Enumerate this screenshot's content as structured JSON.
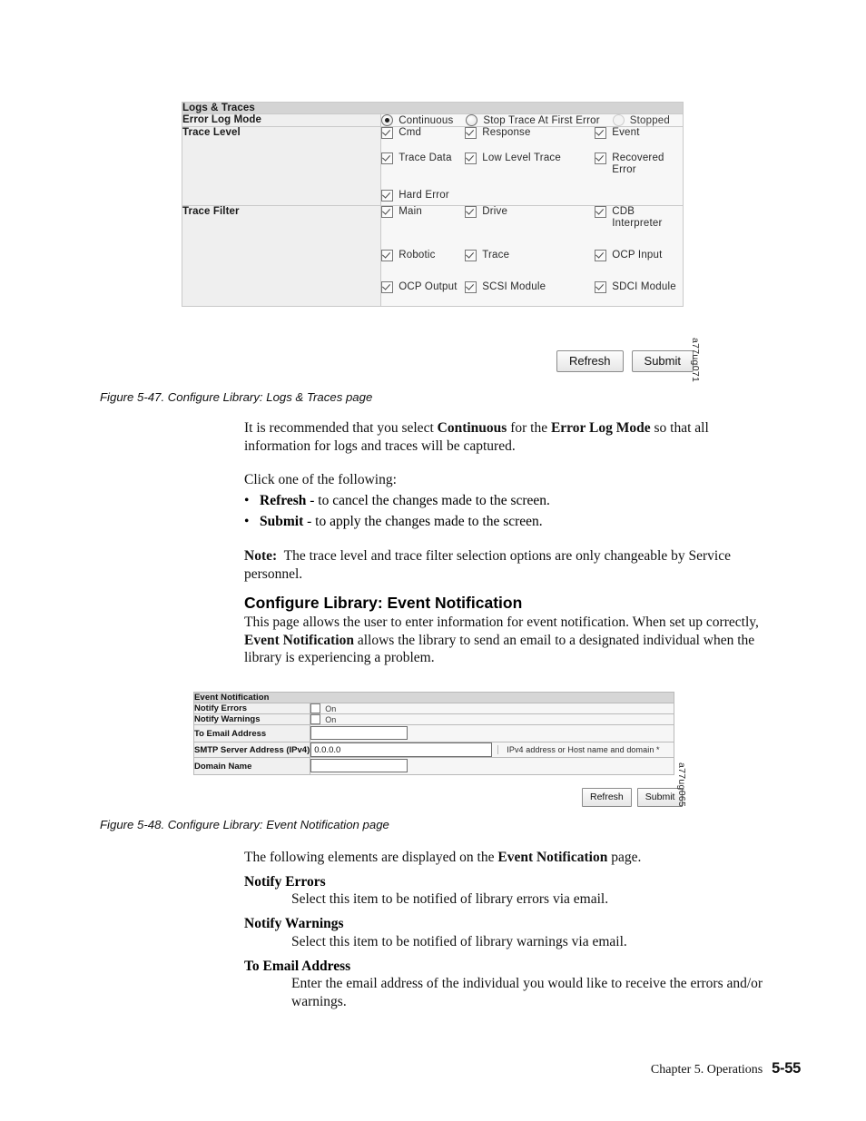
{
  "figure1": {
    "screenshot": {
      "title": "Logs & Traces",
      "rows": {
        "error_log_mode_label": "Error Log Mode",
        "trace_level_label": "Trace Level",
        "trace_filter_label": "Trace Filter"
      },
      "error_log_mode_options": [
        {
          "label": "Continuous",
          "state": "selected"
        },
        {
          "label": "Stop Trace At First Error",
          "state": "unselected"
        },
        {
          "label": "Stopped",
          "state": "disabled"
        }
      ],
      "trace_level_options": [
        {
          "label": "Cmd",
          "checked": true
        },
        {
          "label": "Response",
          "checked": true
        },
        {
          "label": "Event",
          "checked": true
        },
        {
          "label": "Trace Data",
          "checked": true
        },
        {
          "label": "Low Level Trace",
          "checked": true
        },
        {
          "label": "Recovered Error",
          "checked": true
        },
        {
          "label": "Hard Error",
          "checked": true
        }
      ],
      "trace_filter_options": [
        {
          "label": "Main",
          "checked": true
        },
        {
          "label": "Drive",
          "checked": true
        },
        {
          "label": "CDB Interpreter",
          "checked": true
        },
        {
          "label": "Robotic",
          "checked": true
        },
        {
          "label": "Trace",
          "checked": true
        },
        {
          "label": "OCP Input",
          "checked": true
        },
        {
          "label": "OCP Output",
          "checked": true
        },
        {
          "label": "SCSI Module",
          "checked": true
        },
        {
          "label": "SDCI Module",
          "checked": true
        }
      ],
      "buttons": {
        "refresh": "Refresh",
        "submit": "Submit"
      },
      "side_code": "a77ug071"
    },
    "caption": "Figure 5-47. Configure Library: Logs & Traces page"
  },
  "figure2": {
    "screenshot": {
      "title": "Event Notification",
      "rows": [
        {
          "label": "Notify Errors",
          "control": "checkbox",
          "value": "On",
          "checked": false
        },
        {
          "label": "Notify Warnings",
          "control": "checkbox",
          "value": "On",
          "checked": false
        },
        {
          "label": "To Email Address",
          "control": "text",
          "value": ""
        },
        {
          "label": "SMTP Server Address (IPv4)",
          "control": "text",
          "value": "0.0.0.0",
          "hint": "IPv4 address or Host name and domain *"
        },
        {
          "label": "Domain Name",
          "control": "text",
          "value": ""
        }
      ],
      "buttons": {
        "refresh": "Refresh",
        "submit": "Submit"
      },
      "side_code": "a77ug065"
    },
    "caption": "Figure 5-48. Configure Library: Event Notification page"
  },
  "body": {
    "para_recommend_line1_a": "It is recommended that you select ",
    "para_recommend_bold1": "Continuous",
    "para_recommend_line1_b": " for the ",
    "para_recommend_bold2": "Error Log Mode",
    "para_recommend_line1_c": " so that all information for logs and traces will be captured.",
    "click_one_of": "Click one of the following:",
    "bullets": [
      {
        "bold": "Refresh",
        "rest": " - to cancel the changes made to the screen."
      },
      {
        "bold": "Submit",
        "rest": " - to apply the changes made to the screen."
      }
    ],
    "note_label": "Note:",
    "note_text": "The trace level and trace filter selection options are only changeable by Service personnel.",
    "section_heading": "Configure Library: Event Notification",
    "para_event_a": "This page allows the user to enter information for event notification. When set up correctly, ",
    "para_event_bold": "Event Notification",
    "para_event_b": " allows the library to send an email to a designated individual when the library is experiencing a problem.",
    "elements_intro_a": "The following elements are displayed on the ",
    "elements_intro_bold": "Event Notification",
    "elements_intro_b": " page.",
    "definitions": [
      {
        "term": "Notify Errors",
        "desc": "Select this item to be notified of library errors via email."
      },
      {
        "term": "Notify Warnings",
        "desc": "Select this item to be notified of library warnings via email."
      },
      {
        "term": "To Email Address",
        "desc": "Enter the email address of the individual you would like to receive the errors and/or warnings."
      }
    ]
  },
  "footer": {
    "chapter": "Chapter 5. Operations",
    "page": "5-55"
  }
}
